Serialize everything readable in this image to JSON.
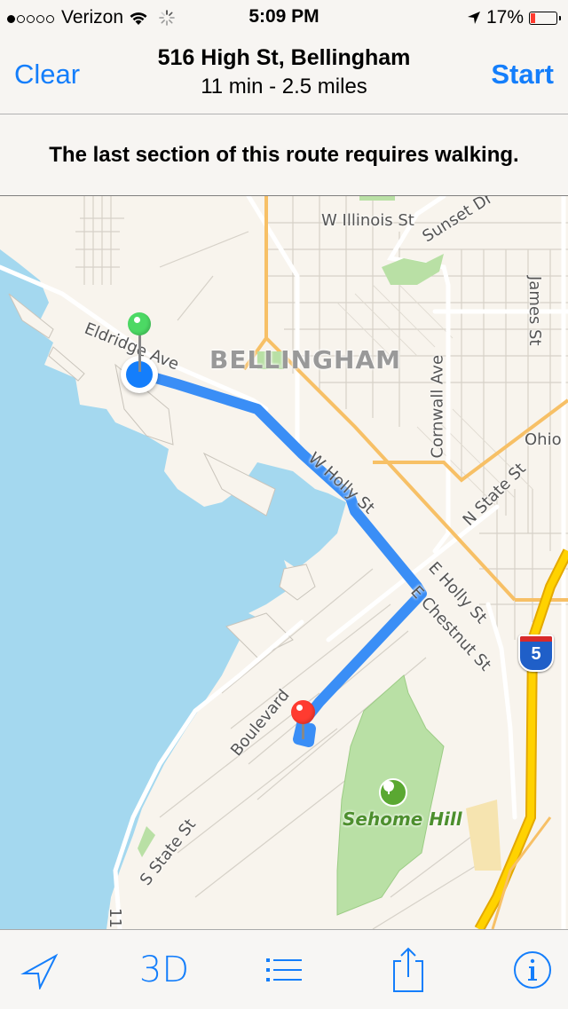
{
  "status_bar": {
    "signal_dots_filled": 1,
    "signal_dots_total": 5,
    "carrier": "Verizon",
    "time": "5:09 PM",
    "battery_percent": "17%",
    "battery_level": 0.17,
    "icons": [
      "wifi-icon",
      "activity-spinner-icon",
      "location-arrow-icon",
      "battery-icon"
    ]
  },
  "nav": {
    "clear_label": "Clear",
    "start_label": "Start",
    "destination": "516 High St, Bellingham",
    "summary": "11 min - 2.5 miles"
  },
  "notice": "The last section of this route requires walking.",
  "map": {
    "city_label": "BELLINGHAM",
    "streets": {
      "w_illinois": "W Illinois St",
      "sunset": "Sunset Dr",
      "james": "James St",
      "eldridge": "Eldridge Ave",
      "cornwall": "Cornwall Ave",
      "ohio": "Ohio",
      "w_holly": "W Holly St",
      "n_state": "N State St",
      "e_holly": "E Holly St",
      "e_chestnut": "E Chestnut St",
      "boulevard": "Boulevard",
      "s_state": "S State St",
      "route_11": "11"
    },
    "park_label": "Sehome Hill",
    "interstate_shield": "5",
    "colors": {
      "land": "#f8f4ed",
      "water": "#a4d8ef",
      "park": "#b9e0a5",
      "route": "#3a8ef6",
      "highway": "#ffd200",
      "arterial": "#f7c066",
      "start_pin": "#4cd964",
      "end_pin": "#ff3b30",
      "current_location": "#147efb"
    }
  },
  "toolbar": {
    "location_label": "current-location",
    "three_d_label": "3D",
    "list_label": "directions-list",
    "share_label": "share",
    "info_label": "info"
  },
  "accent_color": "#147efb"
}
